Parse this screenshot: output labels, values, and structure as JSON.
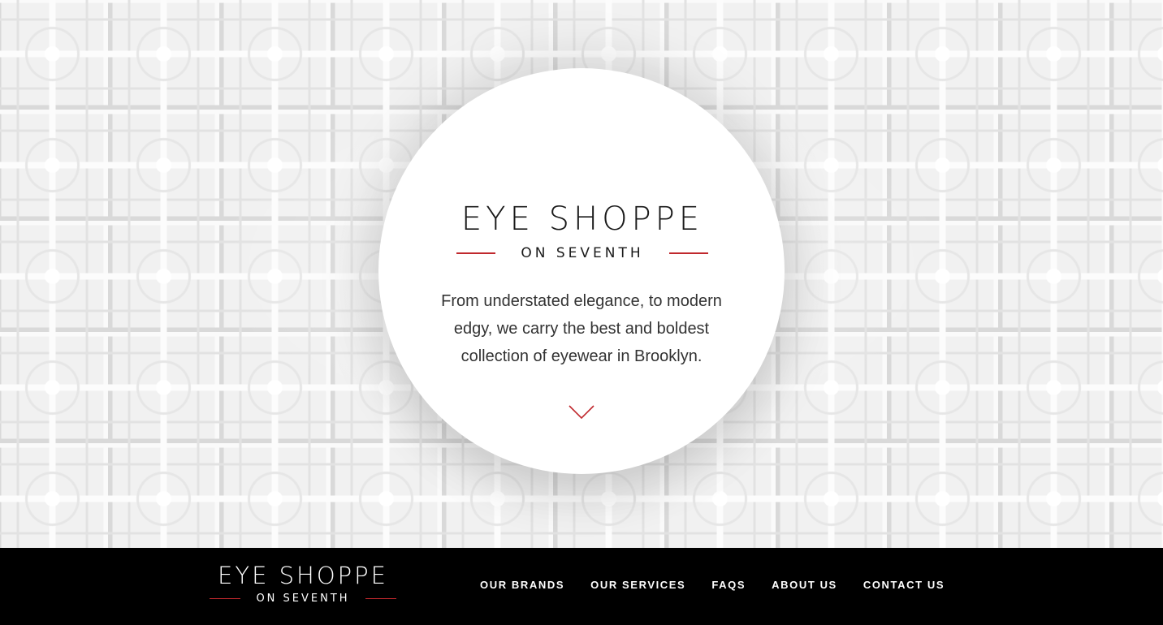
{
  "hero": {
    "logo": {
      "brand": "EYE SHOPPE",
      "sub": "ON SEVENTH"
    },
    "tagline": "From understated elegance, to modern edgy, we carry the best and boldest collection of eyewear in Brooklyn.",
    "scroll_icon": "chevron-down-icon"
  },
  "footer": {
    "logo": {
      "brand": "EYE SHOPPE",
      "sub": "ON SEVENTH"
    },
    "nav": [
      {
        "label": "OUR BRANDS"
      },
      {
        "label": "OUR SERVICES"
      },
      {
        "label": "FAQS"
      },
      {
        "label": "ABOUT US"
      },
      {
        "label": "CONTACT US"
      }
    ]
  },
  "colors": {
    "accent": "#c0282d",
    "footer_bg": "#000000",
    "text": "#333333"
  }
}
